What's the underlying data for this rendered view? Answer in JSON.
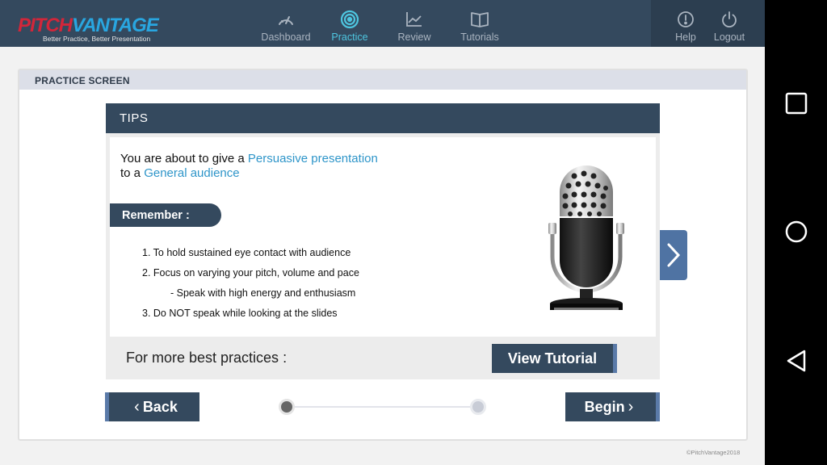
{
  "logo": {
    "part1": "PITCH",
    "part2": "VANTAGE",
    "tagline": "Better Practice, Better Presentation"
  },
  "nav": {
    "items": [
      {
        "label": "Dashboard",
        "icon": "gauge-icon",
        "active": false
      },
      {
        "label": "Practice",
        "icon": "target-icon",
        "active": true
      },
      {
        "label": "Review",
        "icon": "line-chart-icon",
        "active": false
      },
      {
        "label": "Tutorials",
        "icon": "book-icon",
        "active": false
      }
    ],
    "help_label": "Help",
    "logout_label": "Logout"
  },
  "panel": {
    "title": "PRACTICE SCREEN"
  },
  "tips": {
    "title": "TIPS",
    "intro_prefix": "You are about to give a ",
    "presentation_type": "Persuasive presentation",
    "intro_middle": "to a ",
    "audience_type": "General audience",
    "remember_label": "Remember :",
    "items": [
      "1. To hold sustained eye contact with audience",
      "2. Focus on varying your pitch, volume and pace",
      "-  Speak with high energy and enthusiasm",
      "3. Do NOT speak while looking at the slides"
    ],
    "more_label": "For more best practices :",
    "view_tutorial_label": "View Tutorial"
  },
  "actions": {
    "back_label": "Back",
    "begin_label": "Begin"
  },
  "stepper": {
    "current_step": 1,
    "total_steps": 2
  },
  "footer": {
    "copyright": "©PitchVantage2018"
  },
  "colors": {
    "header": "#34495e",
    "accent": "#4ec6e0",
    "highlight_text": "#2e95c9",
    "brand_red": "#d2263a",
    "brand_blue": "#29a6e0"
  }
}
